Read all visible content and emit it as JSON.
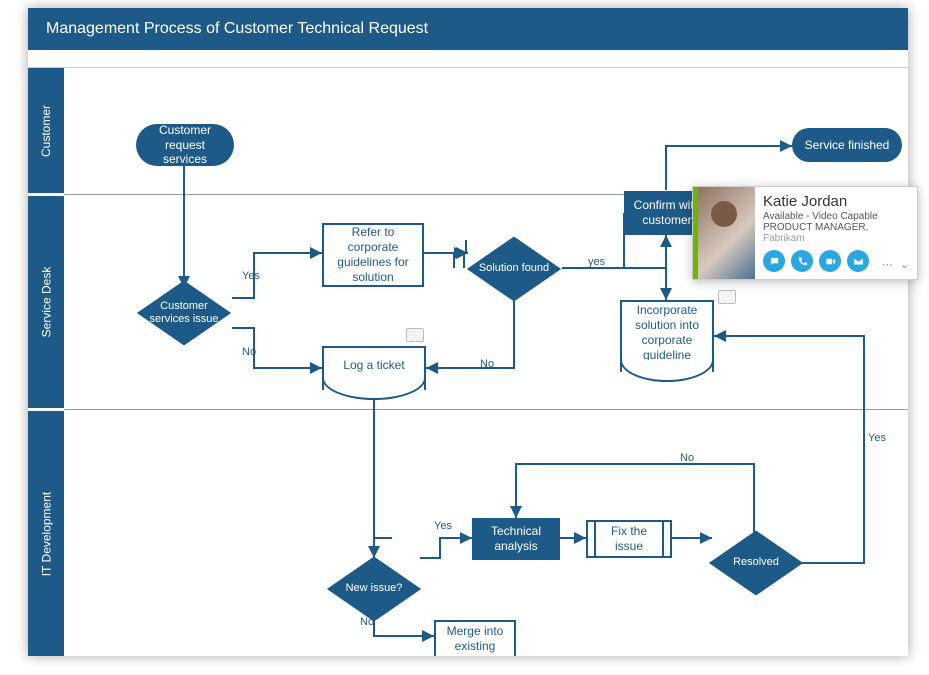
{
  "title": "Management Process of Customer Technical Request",
  "lanes": {
    "customer": "Customer",
    "service_desk": "Service Desk",
    "it_dev": "IT Development"
  },
  "nodes": {
    "start": "Customer request services",
    "end": "Service finished",
    "csi": "Customer services issue",
    "refer": "Refer to corporate guidelines for solution",
    "solution_found": "Solution found",
    "log_ticket": "Log a ticket",
    "confirm": "Confirm with customer",
    "incorporate": "Incorporate solution into corporate guideline",
    "new_issue": "New issue?",
    "tech_analysis": "Technical analysis",
    "fix_issue": "Fix the issue",
    "resolved": "Resolved",
    "merge": "Merge into existing"
  },
  "edges": {
    "yes": "Yes",
    "no": "No",
    "yes_l": "yes"
  },
  "contact": {
    "name": "Katie Jordan",
    "status": "Available - Video Capable",
    "role": "PRODUCT MANAGER,",
    "company": "Fabrikam",
    "actions": {
      "im": "im-icon",
      "call": "call-icon",
      "video": "video-icon",
      "email": "email-icon"
    }
  }
}
